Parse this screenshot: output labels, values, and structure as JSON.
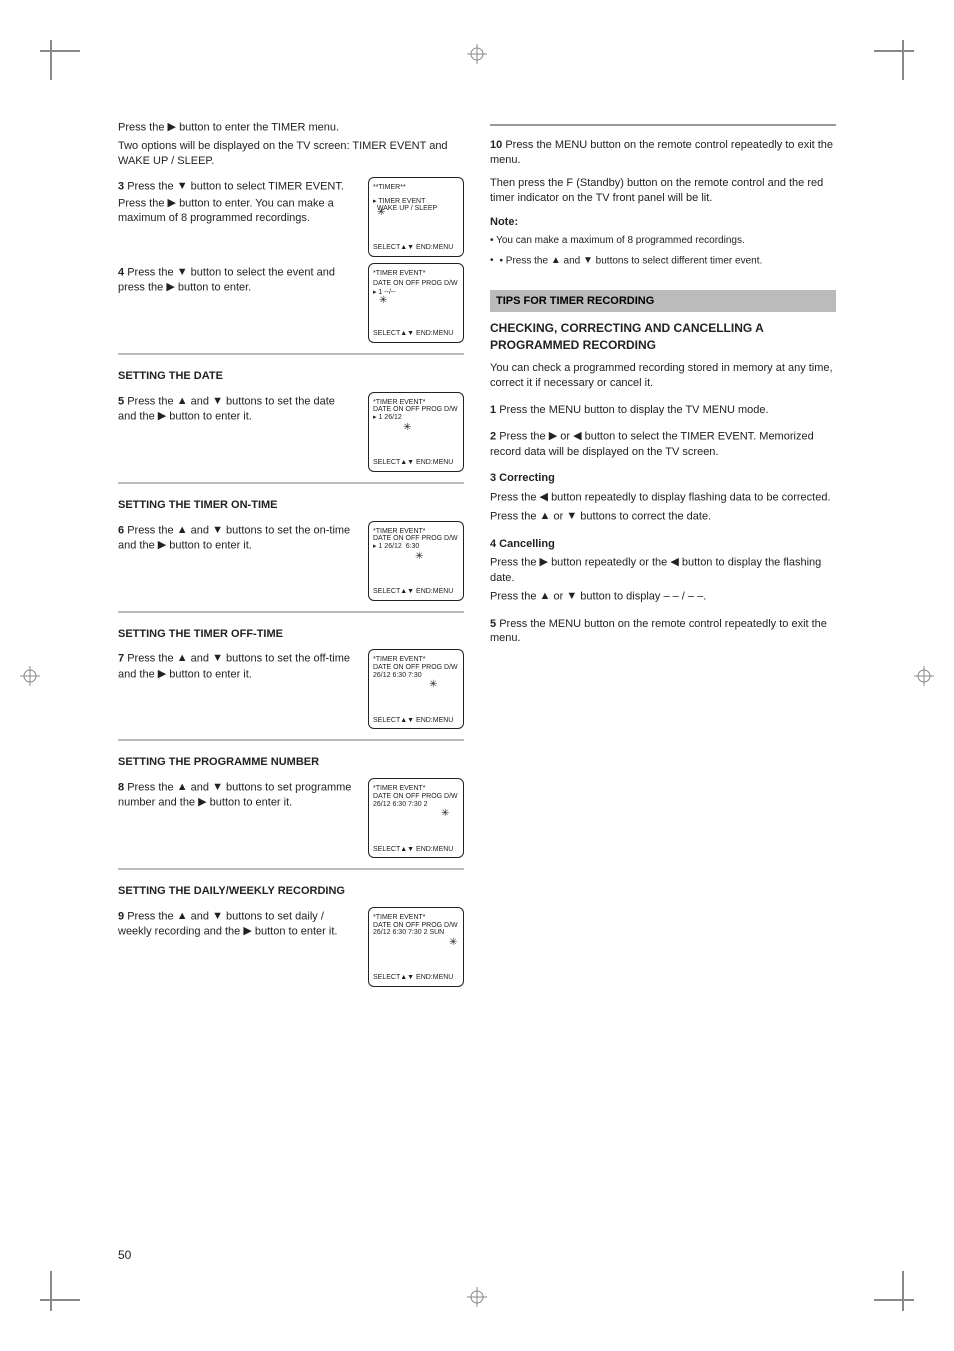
{
  "page_number": "50",
  "left": {
    "intro1": "Press the ",
    "intro1b": " button to enter the TIMER menu.",
    "intro2": "Two options will be displayed on the TV screen: TIMER EVENT and WAKE UP / SLEEP.",
    "s3a": "3",
    "s3b": "Press the ",
    "s3c": " button to select TIMER EVENT.",
    "s3d": "Press the ",
    "s3e": " button to enter. You can make a maximum of 8 programmed recordings.",
    "s4a": "4",
    "s4b": "Press the ",
    "s4c": " button to select the event and press the ",
    "s4d": " button to enter.",
    "s5t": "SETTING THE DATE",
    "s5a": "5",
    "s5b": "Press the ",
    "s5c": " and ",
    "s5d": " buttons to set the date and the ",
    "s5e": " button to enter it.",
    "s6t": "SETTING THE TIMER ON-TIME",
    "s6a": "6",
    "s6b": "Press the ",
    "s6c": " and ",
    "s6d": " buttons to set the on-time and the ",
    "s6e": " button to enter it.",
    "s7t": "SETTING THE TIMER OFF-TIME",
    "s7a": "7",
    "s7b": "Press the ",
    "s7c": " and ",
    "s7d": " buttons to set the off-time and the ",
    "s7e": " button to enter it.",
    "s8t": "SETTING THE PROGRAMME NUMBER",
    "s8a": "8",
    "s8b": "Press the ",
    "s8c": " and ",
    "s8d": " buttons to set programme number and the ",
    "s8e": " button to enter it.",
    "s9t": "SETTING THE DAILY/WEEKLY RECORDING",
    "s9a": "9",
    "s9b": "Press the ",
    "s9c": " and ",
    "s9d": " buttons to set daily / weekly recording and the ",
    "s9e": " button to enter it.",
    "shot_header": "**TIMER**",
    "shot_items1": "TIMER EVENT\nWAKE UP / SLEEP",
    "shot_hint": "SELECT▲▼  END:MENU",
    "shot2_line": "1",
    "shot5_title": "*TIMER EVENT*",
    "shot5_col": "DATE",
    "shot5_val": "26/12",
    "shot6_col": "ON",
    "shot6_val": "6:30",
    "shot7_col": "OFF",
    "shot7_val": "26/12    6:30   7:30",
    "shot8_col": "PROG",
    "shot8_val": "26/12    6:30   7:30     2",
    "shot9_col": "D/W",
    "shot9_val": "26/12  6:30  7:30  2  SUN"
  },
  "right": {
    "s10a": "10",
    "s10b": "Press the MENU button on the remote control repeatedly to exit the menu.",
    "s10c": "Then press the F (Standby) button on the remote control and the red timer indicator on the TV front panel will be lit.",
    "note": "Note:",
    "n1": "• You can make a maximum of 8 programmed recordings.",
    "n2a": "• Press the ",
    "n2b": " and ",
    "n2c": " buttons to select different timer event.",
    "tips_title": "TIPS FOR TIMER RECORDING",
    "tips_h": "CHECKING, CORRECTING AND CANCELLING A PROGRAMMED RECORDING",
    "tips_p": "You can check a programmed recording stored in memory at any time, correct it if necessary or cancel it.",
    "t1a": "1",
    "t1b": "Press the MENU button to display the TV MENU mode.",
    "t2a": "2",
    "t2b": "Press the ",
    "t2c": " or ",
    "t2d": " button to select the TIMER EVENT. Memorized record data will be displayed on the TV screen.",
    "t3a": "3 Correcting",
    "t3b": "Press the ",
    "t3c": " button repeatedly to display flashing data to be corrected.",
    "t3d": "Press the ",
    "t3e": " or ",
    "t3f": " buttons to correct the date.",
    "t4a": "4 Cancelling",
    "t4b": "Press the ",
    "t4c": " button repeatedly or the ",
    "t4d": " button to display the flashing date.",
    "t4e": "Press the ",
    "t4f": " or ",
    "t4g": " button to display – – / – –.",
    "t5a": "5",
    "t5b": "Press the MENU button on the remote control repeatedly to exit the menu."
  }
}
